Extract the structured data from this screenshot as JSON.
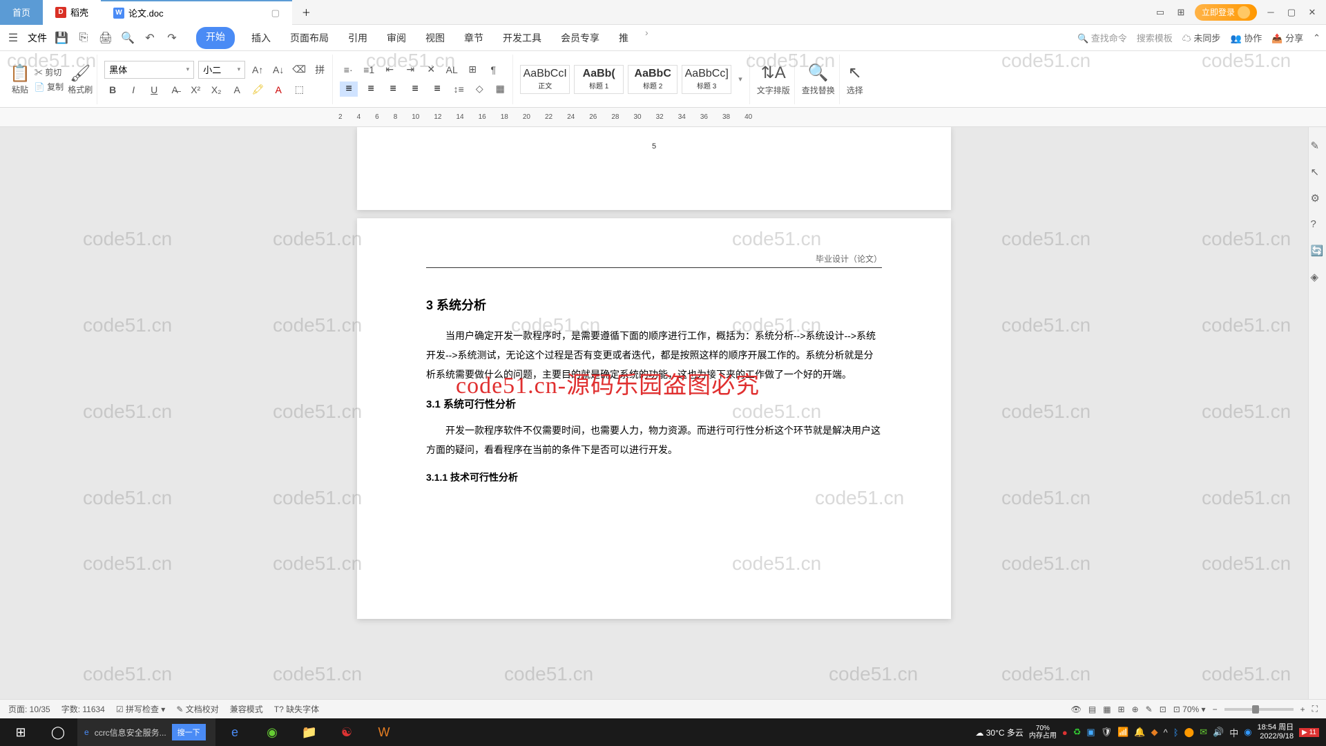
{
  "tabs": {
    "home": "首页",
    "doke": "稻壳",
    "doc": "论文.doc"
  },
  "titlebar": {
    "login": "立即登录"
  },
  "menubar": {
    "file": "文件",
    "tabs": [
      "开始",
      "插入",
      "页面布局",
      "引用",
      "审阅",
      "视图",
      "章节",
      "开发工具",
      "会员专享",
      "推"
    ],
    "search_cmd": "查找命令",
    "search_tpl": "搜索模板",
    "sync": "未同步",
    "coop": "协作",
    "share": "分享"
  },
  "ribbon": {
    "paste": "粘贴",
    "cut": "剪切",
    "copy": "复制",
    "format_painter": "格式刷",
    "font_name": "黑体",
    "font_size": "小二",
    "styles": {
      "s1": {
        "prev": "AaBbCcI",
        "label": "正文"
      },
      "s2": {
        "prev": "AaBb(",
        "label": "标题 1"
      },
      "s3": {
        "prev": "AaBbC",
        "label": "标题 2"
      },
      "s4": {
        "prev": "AaBbCc]",
        "label": "标题 3"
      }
    },
    "text_layout": "文字排版",
    "find_replace": "查找替换",
    "select": "选择"
  },
  "ruler_marks": [
    "2",
    "4",
    "6",
    "8",
    "10",
    "12",
    "14",
    "16",
    "18",
    "20",
    "22",
    "24",
    "26",
    "28",
    "30",
    "32",
    "34",
    "36",
    "38",
    "40"
  ],
  "document": {
    "prev_page_num": "5",
    "header": "毕业设计（论文）",
    "h1": "3  系统分析",
    "p1": "当用户确定开发一款程序时，是需要遵循下面的顺序进行工作，概括为：系统分析-->系统设计-->系统开发-->系统测试，无论这个过程是否有变更或者迭代，都是按照这样的顺序开展工作的。系统分析就是分析系统需要做什么的问题，主要目的就是确定系统的功能，这也为接下来的工作做了一个好的开端。",
    "h2": "3.1  系统可行性分析",
    "p2": "开发一款程序软件不仅需要时间，也需要人力，物力资源。而进行可行性分析这个环节就是解决用户这方面的疑问，看看程序在当前的条件下是否可以进行开发。",
    "h3": "3.1.1  技术可行性分析"
  },
  "statusbar": {
    "page": "页面: 10/35",
    "words": "字数: 11634",
    "spell": "拼写检查",
    "proofread": "文档校对",
    "compat": "兼容模式",
    "missing_font": "缺失字体",
    "zoom": "70%"
  },
  "taskbar": {
    "search_placeholder": "ccrc信息安全服务...",
    "search_btn": "搜一下",
    "weather": "30°C  多云",
    "mem": "内存占用",
    "mem_pct": "70%",
    "time": "18:54 周日",
    "date": "2022/9/18",
    "notif_count": "11"
  },
  "watermark_text": "code51.cn",
  "big_watermark": "code51.cn-源码乐园盗图必究"
}
